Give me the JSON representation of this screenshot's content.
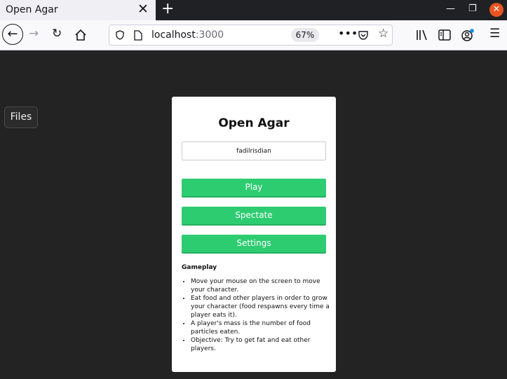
{
  "browser": {
    "tab_title": "Open Agar",
    "url_host": "localhost",
    "url_port": ":3000",
    "zoom": "67%"
  },
  "sidebar": {
    "files_label": "Files"
  },
  "game": {
    "title": "Open Agar",
    "name_value": "fadilrisdian",
    "play_label": "Play",
    "spectate_label": "Spectate",
    "settings_label": "Settings",
    "gameplay_heading": "Gameplay",
    "instructions": [
      "Move your mouse on the screen to move your character.",
      "Eat food and other players in order to grow your character (food respawns every time a player eats it).",
      "A player's mass is the number of food particles eaten.",
      "Objective: Try to get fat and eat other players."
    ]
  },
  "colors": {
    "button_green": "#2ecc71",
    "background": "#232323"
  }
}
